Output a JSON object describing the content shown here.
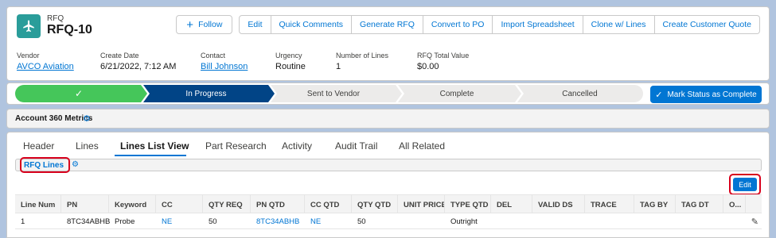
{
  "record": {
    "type_label": "RFQ",
    "name": "RFQ-10",
    "icon": "airplane-icon"
  },
  "actions": {
    "follow": "Follow",
    "buttons": [
      "Edit",
      "Quick Comments",
      "Generate RFQ",
      "Convert to PO",
      "Import Spreadsheet",
      "Clone w/ Lines",
      "Create Customer Quote"
    ]
  },
  "fields": [
    {
      "label": "Vendor",
      "value": "AVCO Aviation",
      "link": true
    },
    {
      "label": "Create Date",
      "value": "6/21/2022, 7:12 AM",
      "link": false
    },
    {
      "label": "Contact",
      "value": "Bill Johnson",
      "link": true
    },
    {
      "label": "Urgency",
      "value": "Routine",
      "link": false
    },
    {
      "label": "Number of Lines",
      "value": "1",
      "link": false
    },
    {
      "label": "RFQ Total Value",
      "value": "$0.00",
      "link": false
    }
  ],
  "path": {
    "steps": [
      {
        "label": "✓",
        "state": "complete"
      },
      {
        "label": "In Progress",
        "state": "current"
      },
      {
        "label": "Sent to Vendor",
        "state": "incomplete"
      },
      {
        "label": "Complete",
        "state": "incomplete"
      },
      {
        "label": "Cancelled",
        "state": "incomplete"
      }
    ],
    "mark_button": "Mark Status as Complete"
  },
  "account360": {
    "label": "Account 360 Metrics"
  },
  "tabs": [
    "Header",
    "Lines",
    "Lines List View",
    "Part Research",
    "Activity",
    "Audit Trail",
    "All Related"
  ],
  "active_tab": "Lines List View",
  "related": {
    "title": "RFQ Lines",
    "edit_button": "Edit"
  },
  "table": {
    "columns": [
      "Line Num",
      "PN",
      "Keyword",
      "CC",
      "QTY REQ",
      "PN QTD",
      "CC QTD",
      "QTY QTD",
      "UNIT PRICE",
      "TYPE QTD",
      "DEL",
      "VALID DS",
      "TRACE",
      "TAG BY",
      "TAG DT",
      "O..."
    ],
    "rows": [
      [
        "1",
        "8TC34ABHB",
        "Probe",
        "NE",
        "50",
        "8TC34ABHB",
        "NE",
        "50",
        "",
        "Outright",
        "",
        "",
        "",
        "",
        "",
        ""
      ]
    ],
    "link_columns": [
      3,
      5,
      6
    ]
  },
  "colors": {
    "complete": "#45c65a",
    "current": "#014486",
    "incomplete": "#ecebea",
    "brand": "#0176d3",
    "highlight": "#d8001c"
  }
}
